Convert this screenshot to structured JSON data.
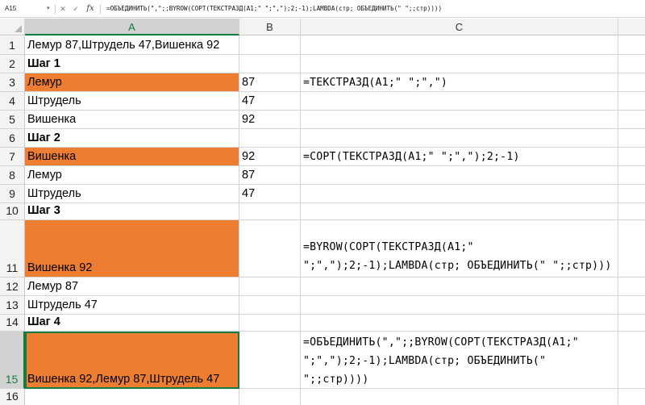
{
  "formula_bar": {
    "name_box": "A15",
    "name_box_arrow": "▾",
    "cancel_icon": "✕",
    "enter_icon": "✓",
    "fx_icon": "fx",
    "formula": "=ОБЪЕДИНИТЬ(\",\";;BYROW(СОРТ(ТЕКСТРАЗД(A1;\" \";\",\");2;-1);LAMBDA(стр; ОБЪЕДИНИТЬ(\" \";;стр))))"
  },
  "columns": [
    "A",
    "B",
    "C"
  ],
  "rows": [
    {
      "num": "1",
      "a": "Лемур 87,Штрудель 47,Вишенка 92",
      "b": "",
      "c": ""
    },
    {
      "num": "2",
      "a": "Шаг 1",
      "b": "",
      "c": ""
    },
    {
      "num": "3",
      "a": "Лемур",
      "b": "87",
      "c": "=ТЕКСТРАЗД(A1;\" \";\",\")"
    },
    {
      "num": "4",
      "a": "Штрудель",
      "b": "47",
      "c": ""
    },
    {
      "num": "5",
      "a": "Вишенка",
      "b": "92",
      "c": ""
    },
    {
      "num": "6",
      "a": "Шаг 2",
      "b": "",
      "c": ""
    },
    {
      "num": "7",
      "a": "Вишенка",
      "b": "92",
      "c": "=СОРТ(ТЕКСТРАЗД(A1;\" \";\",\");2;-1)"
    },
    {
      "num": "8",
      "a": "Лемур",
      "b": "87",
      "c": ""
    },
    {
      "num": "9",
      "a": "Штрудель",
      "b": "47",
      "c": ""
    },
    {
      "num": "10",
      "a": "Шаг 3",
      "b": "",
      "c": ""
    },
    {
      "num": "11",
      "a": "Вишенка 92",
      "b": "",
      "c": "=BYROW(СОРТ(ТЕКСТРАЗД(A1;\" \";\",\");2;-1);LAMBDA(стр; ОБЪЕДИНИТЬ(\" \";;стр)))"
    },
    {
      "num": "12",
      "a": "Лемур 87",
      "b": "",
      "c": ""
    },
    {
      "num": "13",
      "a": "Штрудель 47",
      "b": "",
      "c": ""
    },
    {
      "num": "14",
      "a": "Шаг 4",
      "b": "",
      "c": ""
    },
    {
      "num": "15",
      "a": "Вишенка 92,Лемур 87,Штрудель 47",
      "b": "",
      "c": "=ОБЪЕДИНИТЬ(\",\";;BYROW(СОРТ(ТЕКСТРАЗД(A1;\" \";\",\");2;-1);LAMBDA(стр; ОБЪЕДИНИТЬ(\" \";;стр))))"
    },
    {
      "num": "16",
      "a": "",
      "b": "",
      "c": ""
    }
  ],
  "colors": {
    "highlight": "#ed7d31",
    "selection": "#107c41"
  }
}
